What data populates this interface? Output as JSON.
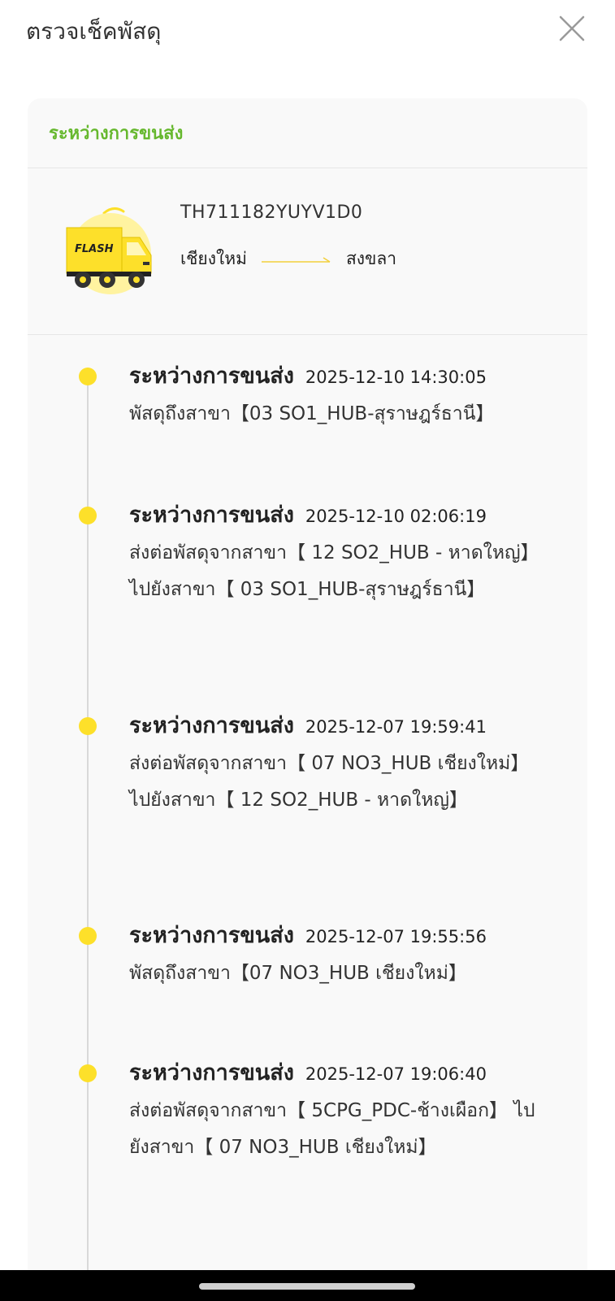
{
  "header": {
    "title": "ตรวจเช็คพัสดุ",
    "close_icon": "close-icon"
  },
  "card": {
    "status_title": "ระหว่างการขนส่ง",
    "parcel": {
      "tracking_number": "TH711182YUYV1D0",
      "origin": "เชียงใหม่",
      "destination": "สงขลา",
      "logo_text": "FLASH"
    },
    "colors": {
      "accent_green": "#66b82e",
      "dot_yellow": "#fde02a"
    },
    "events": [
      {
        "status": "ระหว่างการขนส่ง",
        "time": "2025-12-10 14:30:05",
        "desc": "พัสดุถึงสาขา【03 SO1_HUB-สุราษฎร์ธานี】"
      },
      {
        "status": "ระหว่างการขนส่ง",
        "time": "2025-12-10 02:06:19",
        "desc": "ส่งต่อพัสดุจากสาขา【 12 SO2_HUB - หาดใหญ่】 ไปยังสาขา【 03 SO1_HUB-สุราษฎร์ธานี】"
      },
      {
        "status": "ระหว่างการขนส่ง",
        "time": "2025-12-07 19:59:41",
        "desc": "ส่งต่อพัสดุจากสาขา【 07 NO3_HUB เชียงใหม่】 ไปยังสาขา【 12 SO2_HUB - หาดใหญ่】"
      },
      {
        "status": "ระหว่างการขนส่ง",
        "time": "2025-12-07 19:55:56",
        "desc": "พัสดุถึงสาขา【07 NO3_HUB เชียงใหม่】"
      },
      {
        "status": "ระหว่างการขนส่ง",
        "time": "2025-12-07 19:06:40",
        "desc": "ส่งต่อพัสดุจากสาขา【 5CPG_PDC-ช้างเผือก】 ไปยังสาขา【 07 NO3_HUB เชียงใหม่】"
      }
    ]
  }
}
